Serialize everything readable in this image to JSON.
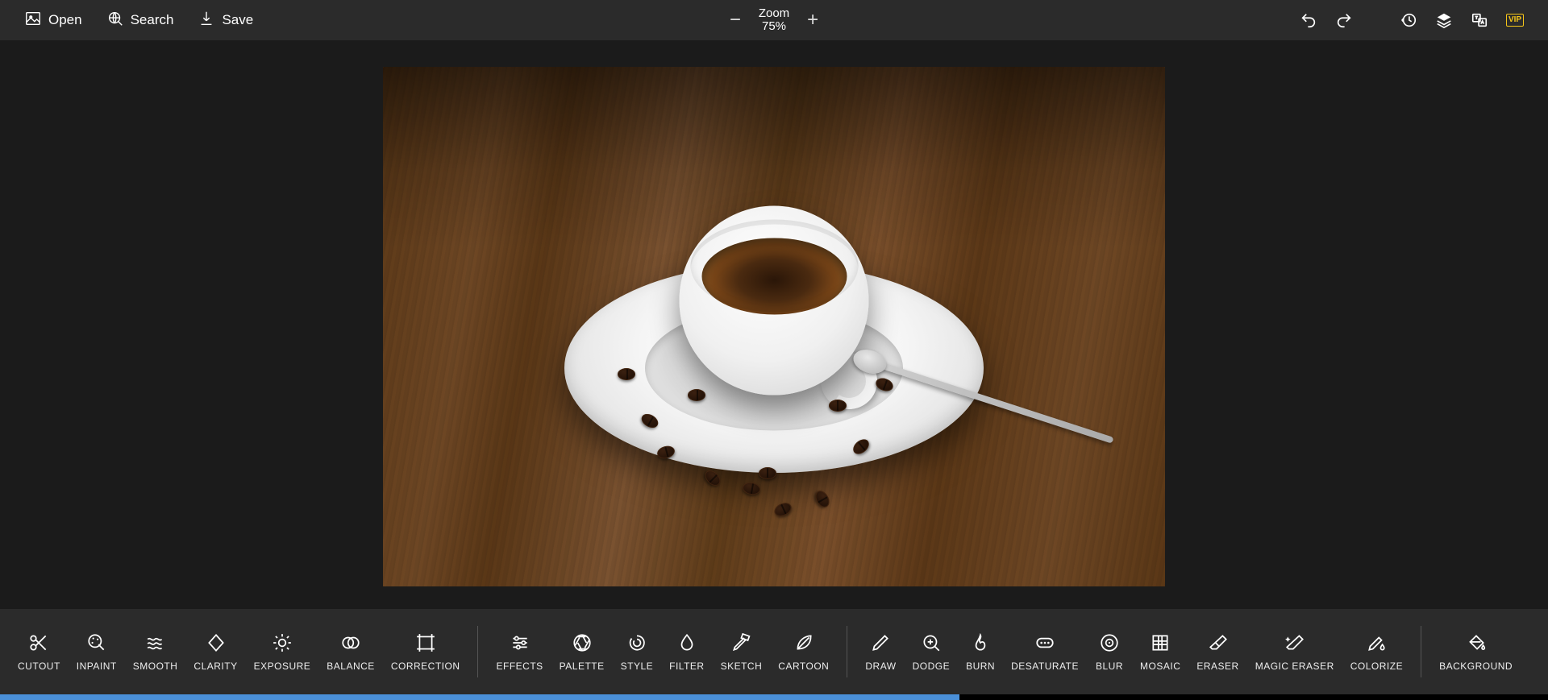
{
  "topbar": {
    "open": "Open",
    "search": "Search",
    "save": "Save",
    "zoom_label": "Zoom",
    "zoom_value": "75%"
  },
  "tools": {
    "group1": [
      {
        "id": "cutout",
        "label": "CUTOUT",
        "icon": "scissors"
      },
      {
        "id": "inpaint",
        "label": "INPAINT",
        "icon": "palette-brush"
      },
      {
        "id": "smooth",
        "label": "SMOOTH",
        "icon": "waves"
      },
      {
        "id": "clarity",
        "label": "CLARITY",
        "icon": "diamond"
      },
      {
        "id": "exposure",
        "label": "EXPOSURE",
        "icon": "sun"
      },
      {
        "id": "balance",
        "label": "BALANCE",
        "icon": "venn"
      },
      {
        "id": "correction",
        "label": "CORRECTION",
        "icon": "crop-frame"
      }
    ],
    "group2": [
      {
        "id": "effects",
        "label": "EFFECTS",
        "icon": "sliders"
      },
      {
        "id": "palette",
        "label": "PALETTE",
        "icon": "aperture"
      },
      {
        "id": "style",
        "label": "STYLE",
        "icon": "swirl"
      },
      {
        "id": "filter",
        "label": "FILTER",
        "icon": "drop"
      },
      {
        "id": "sketch",
        "label": "SKETCH",
        "icon": "pencil-ruler"
      },
      {
        "id": "cartoon",
        "label": "CARTOON",
        "icon": "leaf"
      }
    ],
    "group3": [
      {
        "id": "draw",
        "label": "DRAW",
        "icon": "pencil"
      },
      {
        "id": "dodge",
        "label": "DODGE",
        "icon": "magnify-plus"
      },
      {
        "id": "burn",
        "label": "BURN",
        "icon": "flame"
      },
      {
        "id": "desaturate",
        "label": "DESATURATE",
        "icon": "ellipsis-box"
      },
      {
        "id": "blur",
        "label": "BLUR",
        "icon": "target"
      },
      {
        "id": "mosaic",
        "label": "MOSAIC",
        "icon": "grid"
      },
      {
        "id": "eraser",
        "label": "ERASER",
        "icon": "eraser"
      },
      {
        "id": "magic-eraser",
        "label": "MAGIC ERASER",
        "icon": "wand-eraser"
      },
      {
        "id": "colorize",
        "label": "COLORIZE",
        "icon": "pencil-drop"
      }
    ],
    "group4": [
      {
        "id": "background",
        "label": "BACKGROUND",
        "icon": "bucket"
      }
    ]
  },
  "progress_percent": 62,
  "vip_label": "VIP"
}
